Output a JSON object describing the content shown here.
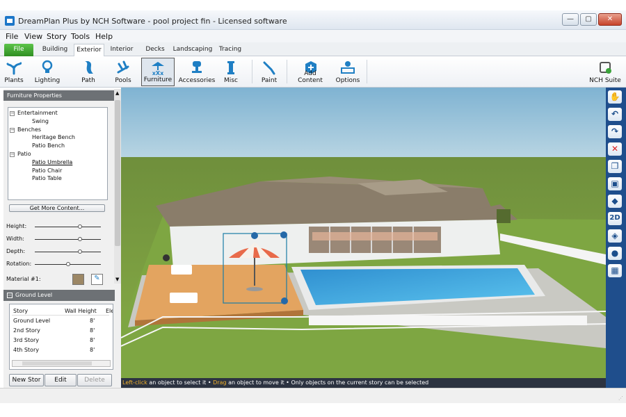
{
  "window": {
    "title": "DreamPlan Plus by NCH Software - pool project fin - Licensed software"
  },
  "menu": [
    "File",
    "View",
    "Story",
    "Tools",
    "Help"
  ],
  "tabs": [
    "File",
    "Building",
    "Exterior",
    "Interior",
    "Decks",
    "Landscaping",
    "Tracing"
  ],
  "active_tab": "Exterior",
  "ribbon": [
    {
      "label": "Plants",
      "icon": "plant-icon",
      "color": "#1f7fc4"
    },
    {
      "label": "Lighting",
      "icon": "lightbulb-icon",
      "color": "#1f7fc4"
    },
    {
      "label": "Path",
      "icon": "path-icon",
      "color": "#1f7fc4"
    },
    {
      "label": "Pools",
      "icon": "pool-ladder-icon",
      "color": "#1f7fc4"
    },
    {
      "label": "Furniture",
      "icon": "furniture-icon",
      "color": "#1f7fc4"
    },
    {
      "label": "Accessories",
      "icon": "accessories-icon",
      "color": "#1f7fc4"
    },
    {
      "label": "Misc",
      "icon": "column-icon",
      "color": "#1f7fc4"
    },
    {
      "label": "Paint",
      "icon": "paint-icon",
      "color": "#1f7fc4"
    },
    {
      "label": "Add Content",
      "icon": "add-content-icon",
      "color": "#1f7fc4"
    },
    {
      "label": "Options",
      "icon": "options-icon",
      "color": "#1f7fc4"
    },
    {
      "label": "NCH Suite",
      "icon": "nch-suite-icon",
      "color": "#555555"
    }
  ],
  "selected_ribbon": "Furniture",
  "furniture_panel": {
    "header": "Furniture Properties",
    "tree": [
      {
        "label": "Entertainment",
        "level": 0,
        "expander": "−"
      },
      {
        "label": "Swing",
        "level": 1
      },
      {
        "label": "Benches",
        "level": 0,
        "expander": "−"
      },
      {
        "label": "Heritage Bench",
        "level": 1
      },
      {
        "label": "Patio Bench",
        "level": 1
      },
      {
        "label": "Patio",
        "level": 0,
        "expander": "−"
      },
      {
        "label": "Patio Umbrella",
        "level": 1,
        "selected": true
      },
      {
        "label": "Patio Chair",
        "level": 1
      },
      {
        "label": "Patio Table",
        "level": 1
      }
    ],
    "get_more": "Get More Content...",
    "sliders": [
      {
        "label": "Height:",
        "value": 0.68
      },
      {
        "label": "Width:",
        "value": 0.68
      },
      {
        "label": "Depth:",
        "value": 0.68
      },
      {
        "label": "Rotation:",
        "value": 0.5
      }
    ],
    "material_label": "Material #1:",
    "material_color": "#9c8765"
  },
  "story_panel": {
    "header": "Ground Level",
    "columns": [
      "Story",
      "Wall Height",
      "Elev"
    ],
    "rows": [
      {
        "story": "Ground Level",
        "height": "8'"
      },
      {
        "story": "2nd Story",
        "height": "8'"
      },
      {
        "story": "3rd Story",
        "height": "8'"
      },
      {
        "story": "4th Story",
        "height": "8'"
      }
    ],
    "buttons": [
      "New Stor",
      "Edit",
      "Delete"
    ]
  },
  "status": {
    "parts": [
      {
        "text": "Left-click",
        "hl": true
      },
      {
        "text": " an object to select it • ",
        "hl": false
      },
      {
        "text": "Drag",
        "hl": true
      },
      {
        "text": " an object to move it • Only objects on the current story can be selected",
        "hl": false
      }
    ]
  },
  "right_tools": [
    "pan-hand-icon",
    "undo-icon",
    "redo-icon",
    "delete-icon",
    "copy-icon",
    "texture-icon",
    "terrain-icon",
    "2D",
    "layers-icon",
    "pin-icon",
    "floorplan-icon"
  ],
  "right_tool_labels": {
    "2D": "2D"
  }
}
